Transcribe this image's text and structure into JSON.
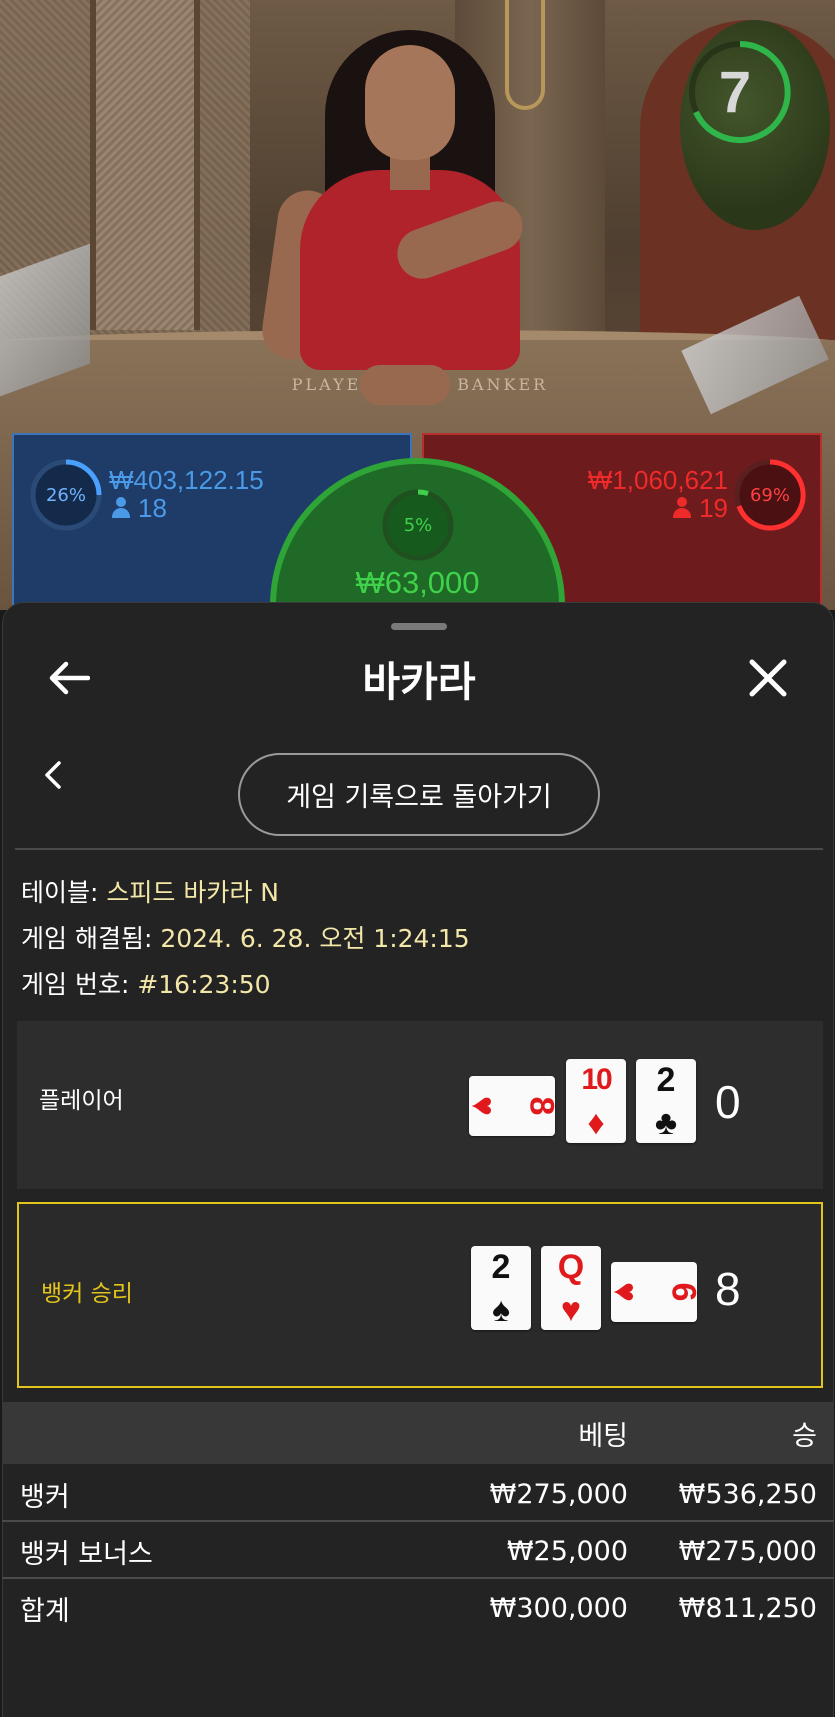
{
  "timer": {
    "seconds": "7"
  },
  "bets": {
    "player": {
      "percent": "26%",
      "amount": "₩403,122.15",
      "count": "18"
    },
    "banker": {
      "percent": "69%",
      "amount": "₩1,060,621",
      "count": "19"
    },
    "tie": {
      "percent": "5%",
      "amount": "₩63,000"
    }
  },
  "table_print": "PLAYER          BANKER",
  "sheet": {
    "title": "바카라",
    "back_button": "게임 기록으로 돌아가기",
    "info": {
      "table_label": "테이블:",
      "table_value": "스피드 바카라 N",
      "resolved_label": "게임 해결됨:",
      "resolved_value": "2024. 6. 28. 오전 1:24:15",
      "number_label": "게임 번호:",
      "number_value": "#16:23:50"
    },
    "player_row": {
      "label": "플레이어",
      "score": "0",
      "cards": [
        {
          "rank": "8",
          "suit": "♥",
          "color": "#e0191d",
          "orientation": "sideways"
        },
        {
          "rank": "10",
          "suit": "♦",
          "color": "#e0191d",
          "orientation": "upright"
        },
        {
          "rank": "2",
          "suit": "♣",
          "color": "#111111",
          "orientation": "upright"
        }
      ]
    },
    "banker_row": {
      "label": "뱅커 승리",
      "label_color": "#e2c41c",
      "score": "8",
      "cards": [
        {
          "rank": "2",
          "suit": "♠",
          "color": "#111111",
          "orientation": "upright"
        },
        {
          "rank": "Q",
          "suit": "♥",
          "color": "#e0191d",
          "orientation": "upright"
        },
        {
          "rank": "6",
          "suit": "♥",
          "color": "#e0191d",
          "orientation": "sideways"
        }
      ]
    },
    "table": {
      "headers": [
        "",
        "베팅",
        "승"
      ],
      "rows": [
        {
          "name": "뱅커",
          "bet": "₩275,000",
          "win": "₩536,250"
        },
        {
          "name": "뱅커 보너스",
          "bet": "₩25,000",
          "win": "₩275,000"
        },
        {
          "name": "합계",
          "bet": "₩300,000",
          "win": "₩811,250"
        }
      ]
    }
  },
  "colors": {
    "accent_win": "#e2c41c",
    "player_blue": "#1f3c68",
    "banker_red": "#6e1b1d",
    "tie_green": "#2fa538"
  }
}
